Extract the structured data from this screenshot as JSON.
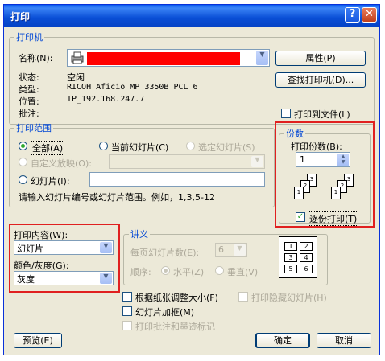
{
  "window": {
    "title": "打印",
    "help_label": "?",
    "close_label": "✕"
  },
  "printer": {
    "group_label": "打印机",
    "name_label": "名称(N):",
    "status_label": "状态:",
    "status_value": "空闲",
    "type_label": "类型:",
    "type_value": "RICOH Aficio MP 3350B PCL 6",
    "location_label": "位置:",
    "location_value": "IP_192.168.247.7",
    "comment_label": "批注:",
    "comment_value": "",
    "properties_button": "属性(P)",
    "find_printer_button": "查找打印机(D)...",
    "print_to_file_label": "打印到文件(L)",
    "print_to_file_checked": false
  },
  "range": {
    "group_label": "打印范围",
    "all_label": "全部(A)",
    "current_slide_label": "当前幻灯片(C)",
    "selection_label": "选定幻灯片(S)",
    "custom_show_label": "自定义放映(O):",
    "slides_label": "幻灯片(I):",
    "slides_value": "",
    "hint": "请输入幻灯片编号或幻灯片范围。例如，1,3,5-12",
    "selected": "all"
  },
  "copies": {
    "group_label": "份数",
    "count_label": "打印份数(B):",
    "count_value": "1",
    "collate_label": "逐份打印(T)",
    "collate_checked": true,
    "collate_icon_pages": [
      "1",
      "2",
      "3",
      "1",
      "2",
      "3"
    ]
  },
  "print_what": {
    "label": "打印内容(W):",
    "value": "幻灯片",
    "color_label": "颜色/灰度(G):",
    "color_value": "灰度"
  },
  "handouts": {
    "group_label": "讲义",
    "per_page_label": "每页幻灯片数(E):",
    "per_page_value": "6",
    "order_label": "顺序:",
    "horizontal_label": "水平(Z)",
    "vertical_label": "垂直(V)",
    "preview_cells": [
      "1",
      "2",
      "3",
      "4",
      "5",
      "6"
    ]
  },
  "options": {
    "scale_to_fit_label": "根据纸张调整大小(F)",
    "print_hidden_label": "打印隐藏幻灯片(H)",
    "frame_slides_label": "幻灯片加框(M)",
    "print_comments_label": "打印批注和墨迹标记"
  },
  "buttons": {
    "preview": "预览(E)",
    "ok": "确定",
    "cancel": "取消"
  },
  "colors": {
    "title_blue": "#0a4fd6",
    "group_blue": "#0046d5",
    "highlight_red": "#e02020",
    "redacted": "#ff0000"
  }
}
